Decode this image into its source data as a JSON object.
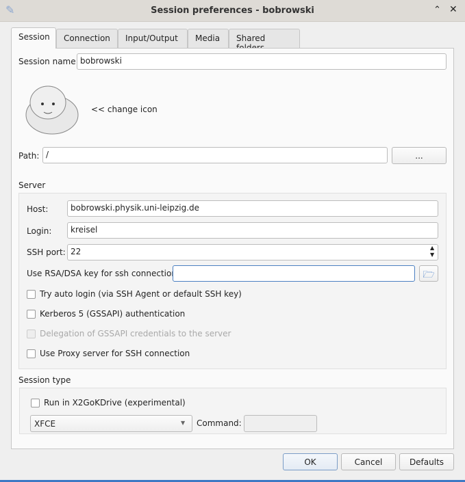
{
  "window": {
    "title": "Session preferences - bobrowski"
  },
  "tabs": [
    {
      "label": "Session",
      "active": true
    },
    {
      "label": "Connection"
    },
    {
      "label": "Input/Output"
    },
    {
      "label": "Media"
    },
    {
      "label": "Shared folders"
    }
  ],
  "session": {
    "name_label": "Session name:",
    "name_value": "bobrowski",
    "change_icon": "<< change icon",
    "path_label": "Path:",
    "path_value": "/",
    "browse_label": "..."
  },
  "server": {
    "group_label": "Server",
    "host_label": "Host:",
    "host_value": "bobrowski.physik.uni-leipzig.de",
    "login_label": "Login:",
    "login_value": "kreisel",
    "port_label": "SSH port:",
    "port_value": "22",
    "key_label": "Use RSA/DSA key for ssh connection:",
    "key_value": "",
    "checkboxes": [
      {
        "label": "Try auto login (via SSH Agent or default SSH key)",
        "checked": false,
        "enabled": true
      },
      {
        "label": "Kerberos 5 (GSSAPI) authentication",
        "checked": false,
        "enabled": true
      },
      {
        "label": "Delegation of GSSAPI credentials to the server",
        "checked": false,
        "enabled": false
      },
      {
        "label": "Use Proxy server for SSH connection",
        "checked": false,
        "enabled": true
      }
    ]
  },
  "session_type": {
    "group_label": "Session type",
    "kdrive_label": "Run in X2GoKDrive (experimental)",
    "kdrive_checked": false,
    "type_value": "XFCE",
    "command_label": "Command:",
    "command_value": ""
  },
  "buttons": {
    "ok": "OK",
    "cancel": "Cancel",
    "defaults": "Defaults"
  }
}
